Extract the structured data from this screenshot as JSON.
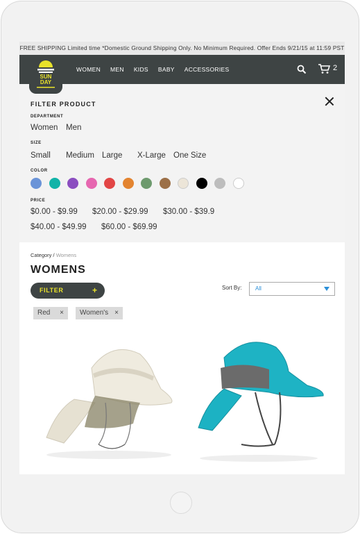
{
  "promo": {
    "text": "FREE SHIPPING Limited time *Domestic Ground Shipping Only. No Minimum Required. Offer Ends 9/21/15 at 11:59 PST"
  },
  "brand": {
    "logo_icon": "sunday-afternoons-logo",
    "logo_text_1": "SUN",
    "logo_text_2": "DAY"
  },
  "nav": {
    "items": [
      "WOMEN",
      "MEN",
      "KIDS",
      "BABY",
      "ACCESSORIES"
    ],
    "search_icon": "search-icon",
    "cart_icon": "cart-icon",
    "cart_count": "2"
  },
  "filter_panel": {
    "title": "FILTER PRODUCT",
    "close_icon": "close-icon",
    "department": {
      "label": "DEPARTMENT",
      "options": [
        "Women",
        "Men"
      ]
    },
    "size": {
      "label": "SIZE",
      "options": [
        "Small",
        "Medium",
        "Large",
        "X-Large",
        "One Size"
      ]
    },
    "color": {
      "label": "COLOR",
      "swatches": [
        "#6b94d8",
        "#12b3a8",
        "#8b4ec0",
        "#e667b0",
        "#e24646",
        "#e38430",
        "#6e9a6e",
        "#9c7048",
        "#ece5d8",
        "#000000",
        "#bdbdbd",
        "#ffffff"
      ]
    },
    "price": {
      "label": "PRICE",
      "options": [
        "$0.00 - $9.99",
        "$20.00 - $29.99",
        "$30.00 - $39.9",
        "$40.00 - $49.99",
        "$60.00 - $69.99"
      ]
    }
  },
  "breadcrumb": {
    "root": "Category",
    "separator": "/",
    "current": "Womens"
  },
  "page_title": "WOMENS",
  "filter_button": {
    "label": "FILTER",
    "icon": "+"
  },
  "sort": {
    "label": "Sort By:",
    "value": "All"
  },
  "active_filters": [
    {
      "label": "Red",
      "remove": "×"
    },
    {
      "label": "Women's",
      "remove": "×"
    }
  ],
  "products": [
    {
      "image": "cream-sun-hat-with-neck-flap",
      "color": "#efebdf"
    },
    {
      "image": "teal-sun-hat-with-neck-flap",
      "color": "#1eb3c4"
    }
  ],
  "accent_color": "#e8e22b",
  "nav_color": "#3e4444"
}
